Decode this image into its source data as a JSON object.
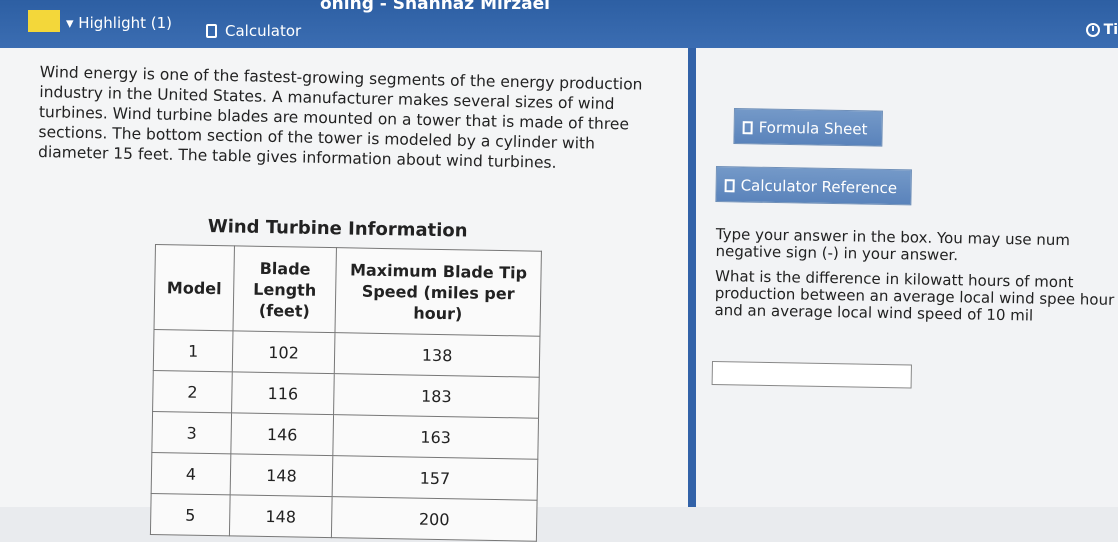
{
  "header": {
    "title_fragment": "oning - Shahnaz Mirzaei",
    "highlight_label": "▾ Highlight (1)",
    "calculator_label": "Calculator",
    "timer_label": "Ti"
  },
  "passage": {
    "text": "Wind energy is one of the fastest-growing segments of the energy production industry in the United States. A manufacturer makes several sizes of wind turbines. Wind turbine blades are mounted on a tower that is made of three sections. The bottom section of the tower is modeled by a cylinder with diameter 15 feet. The table gives information about wind turbines."
  },
  "table": {
    "title": "Wind Turbine Information",
    "headers": [
      "Model",
      "Blade Length (feet)",
      "Maximum Blade Tip Speed (miles per hour)"
    ],
    "rows": [
      [
        "1",
        "102",
        "138"
      ],
      [
        "2",
        "116",
        "183"
      ],
      [
        "3",
        "146",
        "163"
      ],
      [
        "4",
        "148",
        "157"
      ],
      [
        "5",
        "148",
        "200"
      ]
    ]
  },
  "right_panel": {
    "formula_sheet_label": "Formula Sheet",
    "calculator_reference_label": "Calculator Reference",
    "instruction": "Type your answer in the box. You may use num negative sign (-) in your answer.",
    "question": "What is the difference in kilowatt hours of mont production between an average local wind spee hour and an average local wind speed of 10 mil",
    "answer_value": ""
  }
}
